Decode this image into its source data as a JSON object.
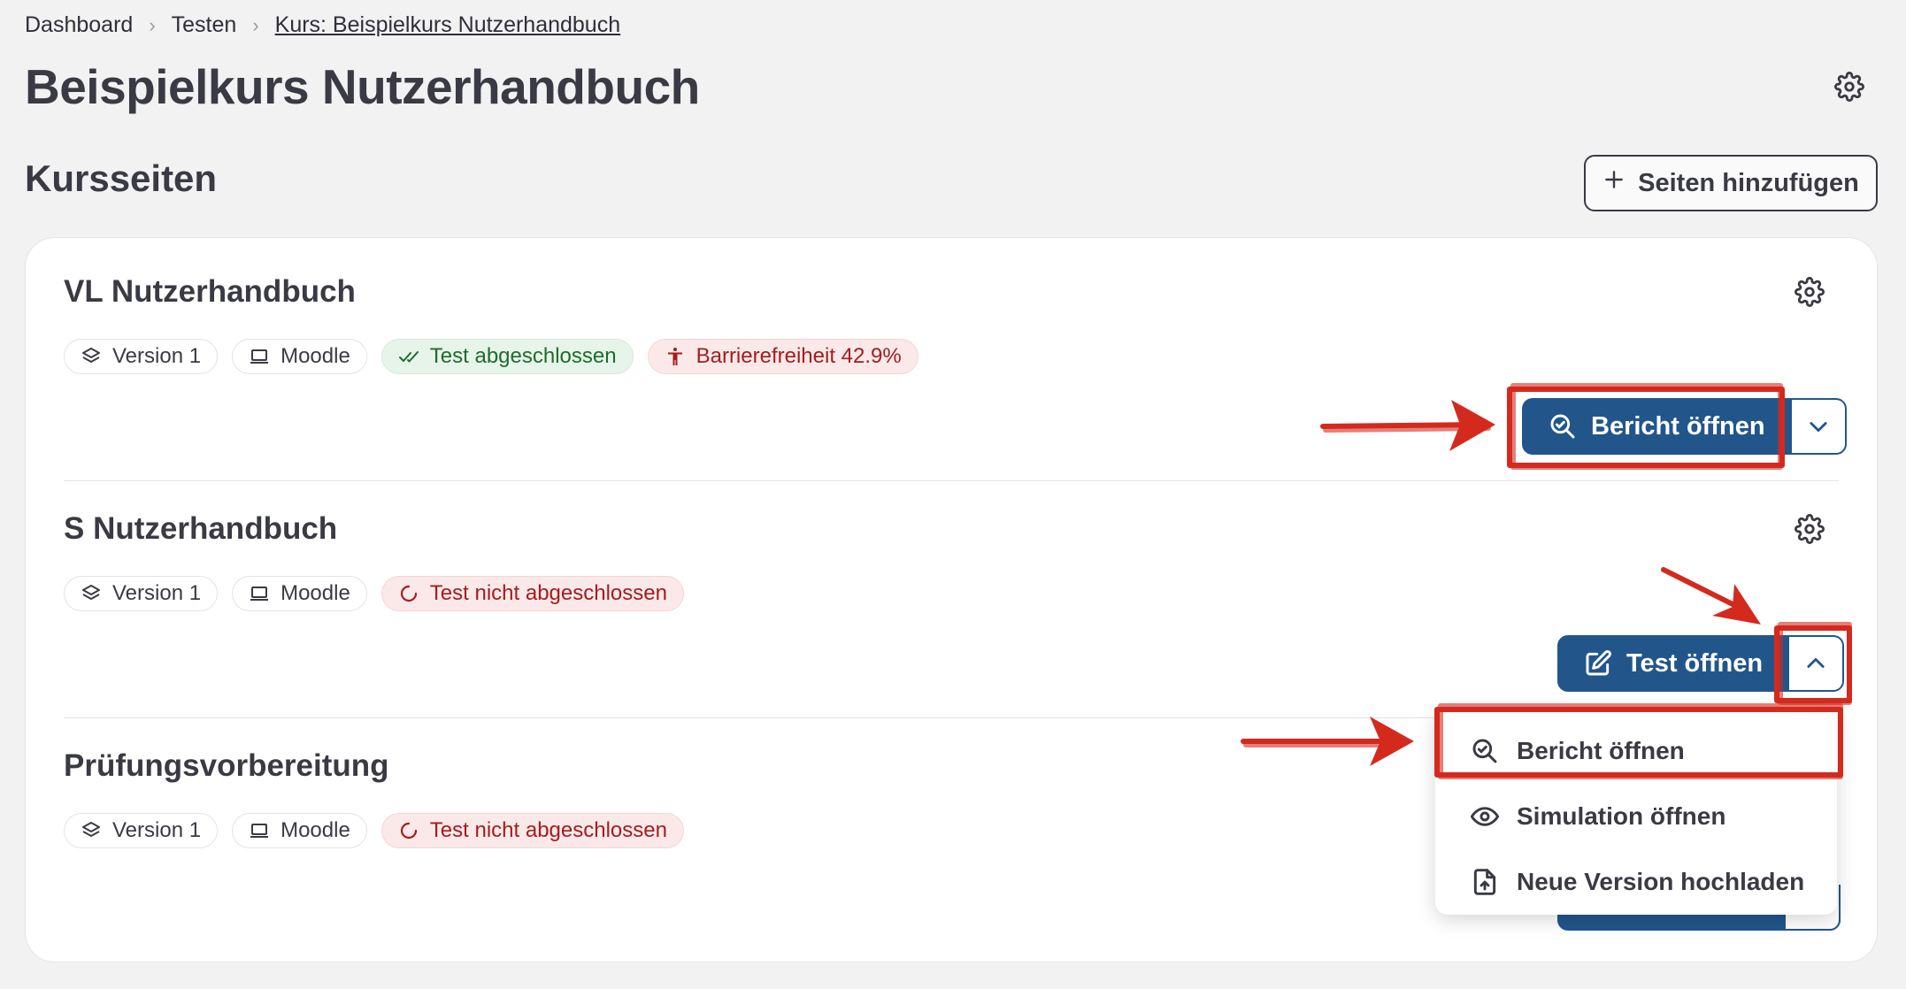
{
  "breadcrumb": {
    "items": [
      "Dashboard",
      "Testen",
      "Kurs: Beispielkurs Nutzerhandbuch"
    ]
  },
  "page": {
    "title": "Beispielkurs Nutzerhandbuch",
    "settings_icon": "gear-icon"
  },
  "section": {
    "title": "Kursseiten",
    "add_button_label": "Seiten hinzufügen",
    "add_icon": "plus-icon"
  },
  "items": [
    {
      "title": "VL Nutzerhandbuch",
      "version": "Version 1",
      "platform": "Moodle",
      "status": "Test abgeschlossen",
      "accessibility": "Barrierefreiheit 42.9%",
      "primary_button": "Bericht öffnen",
      "primary_icon": "search-report-icon",
      "dropdown_state": "collapsed"
    },
    {
      "title": "S Nutzerhandbuch",
      "version": "Version 1",
      "platform": "Moodle",
      "status": "Test nicht abgeschlossen",
      "primary_button": "Test öffnen",
      "primary_icon": "edit-icon",
      "dropdown_state": "expanded"
    },
    {
      "title": "Prüfungsvorbereitung",
      "version": "Version 1",
      "platform": "Moodle",
      "status": "Test nicht abgeschlossen"
    }
  ],
  "dropdown_menu": {
    "items": [
      {
        "label": "Bericht öffnen",
        "icon": "search-report-icon"
      },
      {
        "label": "Simulation öffnen",
        "icon": "eye-icon"
      },
      {
        "label": "Neue Version hochladen",
        "icon": "upload-file-icon"
      }
    ]
  },
  "colors": {
    "primary": "#22568b",
    "success_bg": "#e7f4ea",
    "success_text": "#1f6b2c",
    "danger_bg": "#fbe9e9",
    "danger_text": "#a31d1d",
    "annotation": "#d42a1e"
  }
}
